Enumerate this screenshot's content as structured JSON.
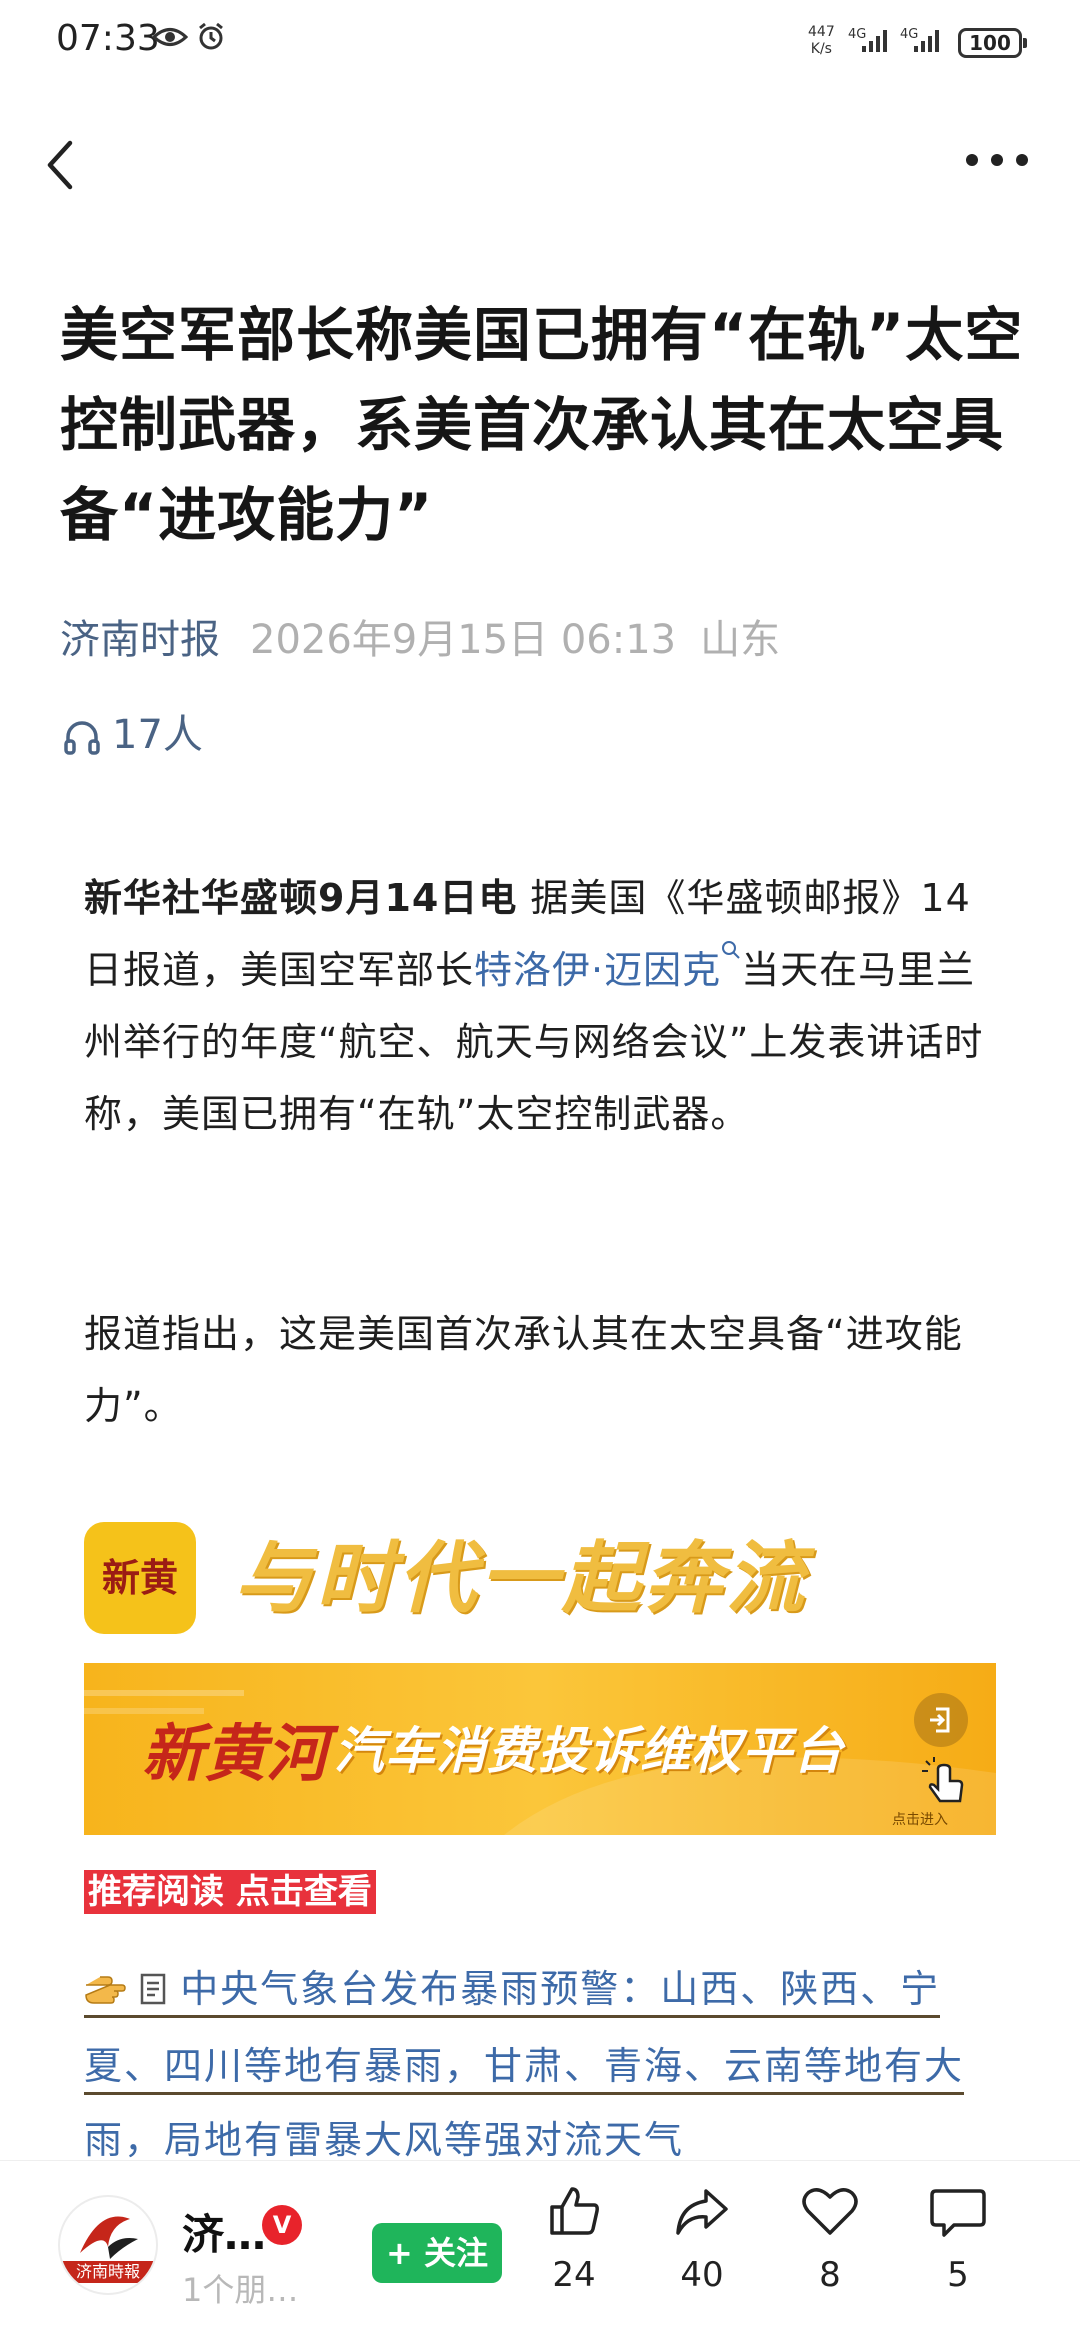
{
  "status_bar": {
    "time": "07:33",
    "net_speed_value": "447",
    "net_speed_unit": "K/s",
    "network_1": "4G",
    "network_2": "4G",
    "battery": "100"
  },
  "article": {
    "title": "美空军部长称美国已拥有“在轨”太空控制武器，系美首次承认其在太空具备“进攻能力”",
    "source": "济南时报",
    "date": "2026年9月15日 06:13",
    "region": "山东",
    "listeners": "17人",
    "p1_lead": "新华社华盛顿9月14日电",
    "p1_a": " 据美国《华盛顿邮报》14日报道，美国空军部长",
    "p1_link": "特洛伊·迈因克",
    "p1_b": "当天在马里兰州举行的年度“航空、航天与网络会议”上发表讲话时称，美国已拥有“在轨”太空控制武器。",
    "p2": "报道指出，这是美国首次承认其在太空具备“进攻能力”。"
  },
  "banner1": {
    "logo_text": "新黄河",
    "slogan": "与时代一起奔流"
  },
  "banner2": {
    "brand": "新黄河",
    "platform": "汽车消费投诉维权平台",
    "enter_label": "点击进入"
  },
  "recommend_label": "推荐阅读 点击查看",
  "related": {
    "headline": "中央气象台发布暴雨预警：山西、陕西、宁夏、四川等地有暴雨，甘肃、青海、云南等地有大雨，局地有雷暴大风等强对流天气"
  },
  "bottom": {
    "account_name": "济…",
    "account_sub": "1个朋…",
    "verified_mark": "V",
    "avatar_caption": "济南時報",
    "follow_label": "+ 关注",
    "likes": "24",
    "shares": "40",
    "favorites": "8",
    "comments": "5"
  },
  "colors": {
    "link": "#3d6aa8",
    "follow_green": "#1fb55b",
    "badge_red": "#e8323c"
  }
}
